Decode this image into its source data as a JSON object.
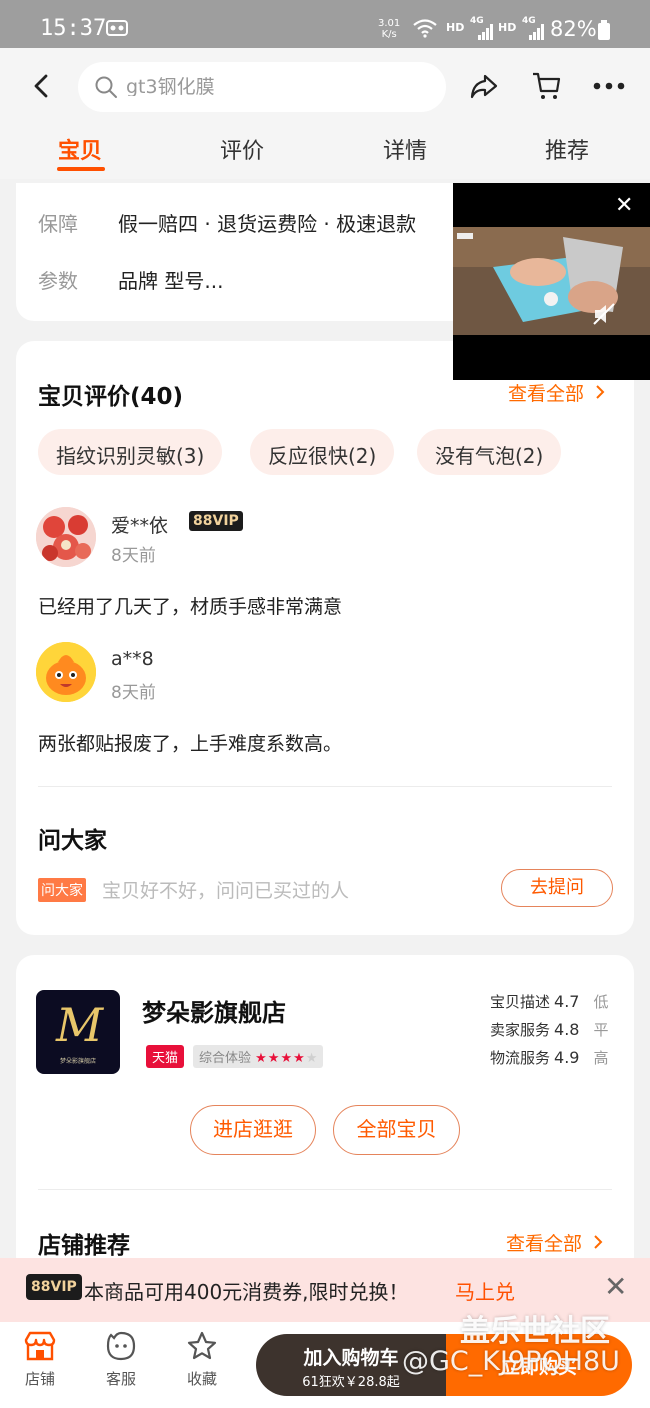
{
  "status_bar": {
    "time": "15:37",
    "speed_value": "3.01",
    "speed_unit": "K/s",
    "net1": "HD",
    "net2": "4G",
    "net3": "HD",
    "net4": "4G",
    "battery": "82%"
  },
  "header": {
    "search_value": "gt3钢化膜",
    "icons": [
      "back-arrow-icon",
      "search-icon",
      "share-icon",
      "cart-icon",
      "more-icon"
    ]
  },
  "tabs": [
    {
      "label": "宝贝",
      "active": true
    },
    {
      "label": "评价",
      "active": false
    },
    {
      "label": "详情",
      "active": false
    },
    {
      "label": "推荐",
      "active": false
    }
  ],
  "guarantee": {
    "label": "保障",
    "value": "假一赔四 · 退货运费险 · 极速退款"
  },
  "params": {
    "label": "参数",
    "value": "品牌 型号..."
  },
  "reviews": {
    "title": "宝贝评价(40)",
    "see_all": "查看全部",
    "tags": [
      "指纹识别灵敏(3)",
      "反应很快(2)",
      "没有气泡(2)"
    ],
    "items": [
      {
        "user": "爱**依",
        "vip": "88VIP",
        "time": "8天前",
        "text": "已经用了几天了，材质手感非常满意"
      },
      {
        "user": "a**8",
        "time": "8天前",
        "text": "两张都贴报废了，上手难度系数高。"
      }
    ]
  },
  "ask": {
    "title": "问大家",
    "tag": "问大家",
    "placeholder": "宝贝好不好，问问已买过的人",
    "button": "去提问"
  },
  "shop": {
    "name": "梦朵影旗舰店",
    "logo_letter": "M",
    "logo_sub": "梦朵影旗舰店",
    "tmall": "天猫",
    "overall_label": "综合体验",
    "overall_stars": 4,
    "ratings": [
      {
        "label": "宝贝描述",
        "score": "4.7",
        "level": "低"
      },
      {
        "label": "卖家服务",
        "score": "4.8",
        "level": "平"
      },
      {
        "label": "物流服务",
        "score": "4.9",
        "level": "高"
      }
    ],
    "enter_button": "进店逛逛",
    "all_button": "全部宝贝"
  },
  "store_recommend": {
    "title": "店铺推荐",
    "see_all": "查看全部"
  },
  "promo": {
    "badge": "88VIP",
    "text": "本商品可用400元消费券,限时兑换！",
    "cta": "马上兑"
  },
  "bottom_bar": {
    "items": [
      {
        "label": "店铺",
        "icon": "store-icon"
      },
      {
        "label": "客服",
        "icon": "service-icon"
      },
      {
        "label": "收藏",
        "icon": "star-icon"
      }
    ],
    "cart_label": "加入购物车",
    "cart_sub": "61狂欢￥28.8起",
    "buy_label": "立即购买"
  },
  "watermark": {
    "line1": "盖乐世社区",
    "line2": "@GC_KJ9PQH8U"
  },
  "colors": {
    "accent": "#ff5000",
    "status_bar": "#9e9e9e",
    "tmall_red": "#e8103a",
    "cart_button": "#3d332d"
  }
}
